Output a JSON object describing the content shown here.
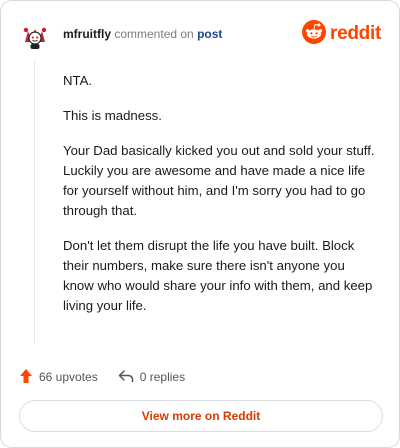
{
  "comment": {
    "author": "mfruitfly",
    "action": "commented on",
    "target": "post",
    "avatar_icon": "reddit-snoo-avatar-icon",
    "paragraphs": [
      "NTA.",
      "This is madness.",
      "Your Dad basically kicked you out and sold your stuff. Luckily you are awesome and have made a nice life for yourself without him, and I'm sorry you had to go through that.",
      "Don't let them disrupt the life you have built. Block their numbers, make sure there isn't anyone you know who would share your info with them, and keep living your life."
    ]
  },
  "brand": {
    "name": "reddit",
    "icon": "reddit-logo-icon",
    "color": "#ff4500"
  },
  "stats": {
    "upvotes": "66 upvotes",
    "upvote_icon": "upvote-arrow-icon",
    "replies": "0 replies",
    "reply_icon": "reply-arrow-icon"
  },
  "cta": {
    "view_more": "View more on Reddit",
    "color": "#d93a00"
  }
}
